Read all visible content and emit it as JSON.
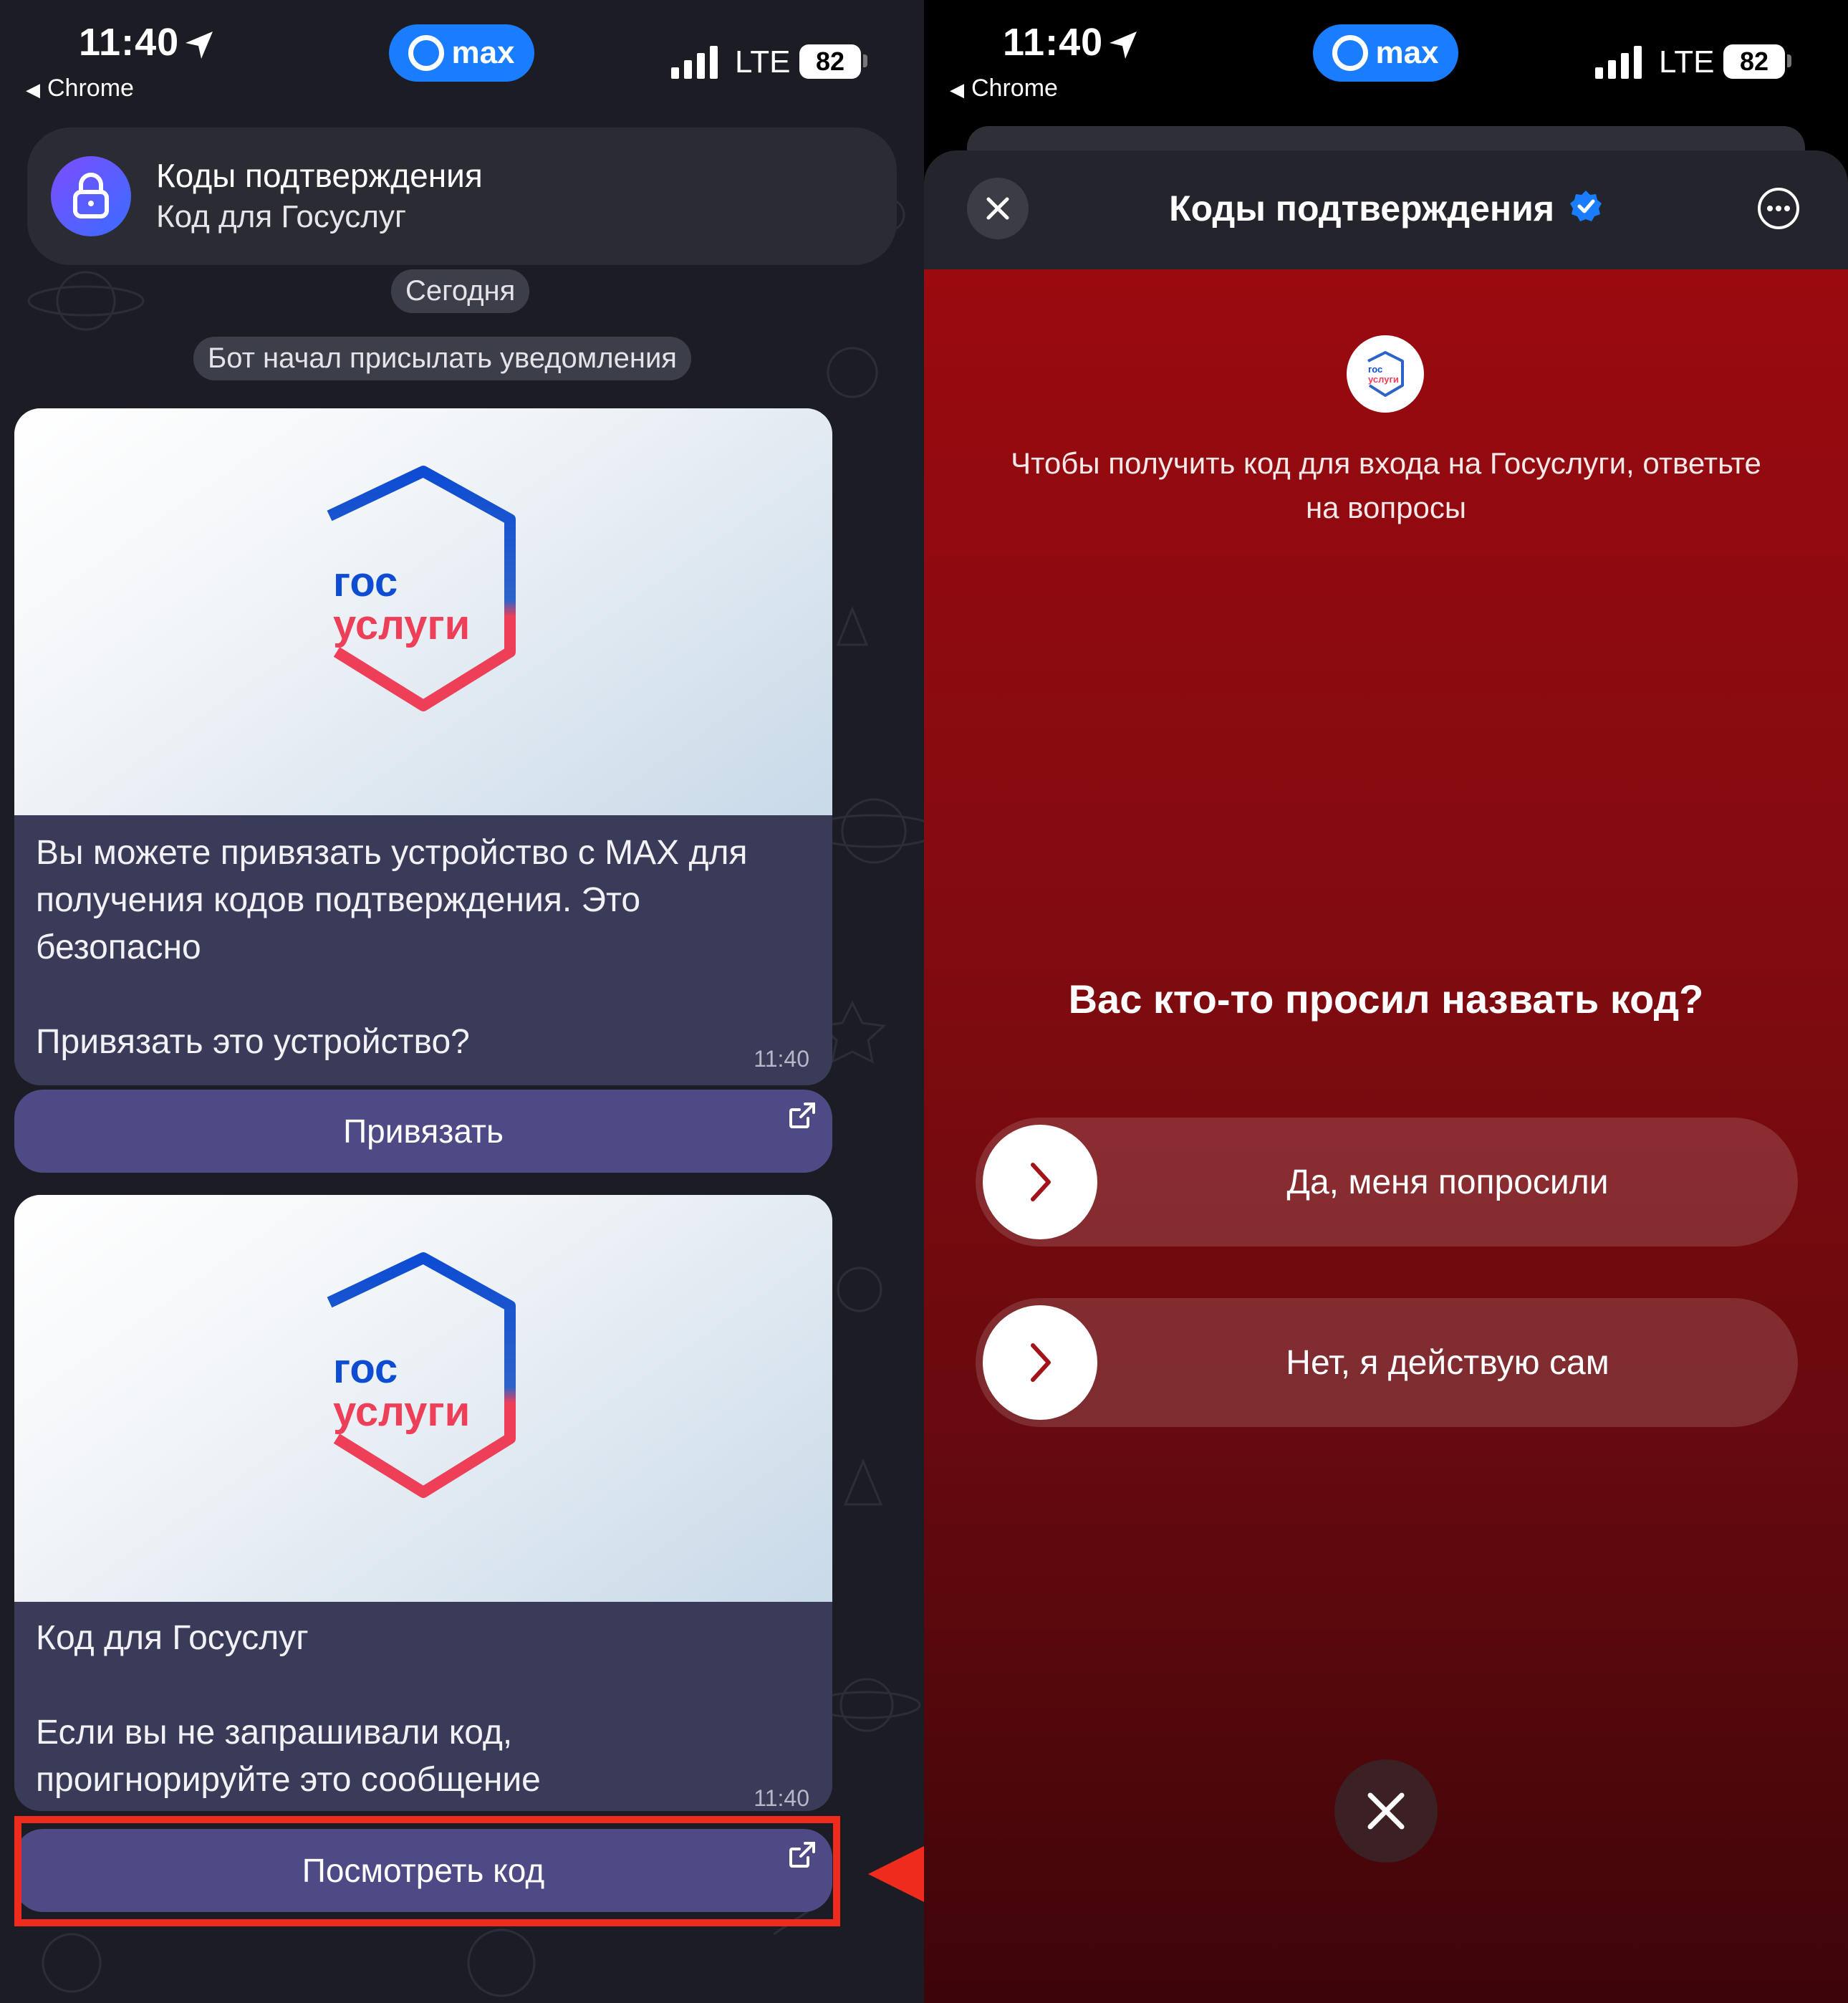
{
  "status_bar": {
    "time": "11:40",
    "back_app": "Chrome",
    "app_badge": "max",
    "network": "LTE",
    "battery": "82"
  },
  "left": {
    "header": {
      "title": "Коды подтверждения",
      "subtitle": "Код для Госуслуг"
    },
    "date_label": "Сегодня",
    "system_message": "Бот начал присылать уведомления",
    "logo_text": {
      "line1": "гос",
      "line2": "услуги"
    },
    "message1": {
      "lines": [
        "Вы можете привязать устройство с MAX для",
        "получения кодов подтверждения. Это",
        "безопасно",
        "",
        "Привязать это устройство?"
      ],
      "time": "11:40",
      "button": "Привязать"
    },
    "message2": {
      "lines": [
        "Код для Госуслуг",
        "",
        "Если вы не запрашивали код,",
        "проигнорируйте это сообщение"
      ],
      "time": "11:40",
      "button": "Посмотреть код"
    }
  },
  "right": {
    "title": "Коды подтверждения",
    "logo_text": {
      "line1": "гос",
      "line2": "услуги"
    },
    "description_lines": [
      "Чтобы получить код для входа на Госуслуги, ответьте",
      "на вопросы"
    ],
    "question": "Вас кто-то просил назвать код?",
    "options": [
      "Да, меня попросили",
      "Нет, я действую сам"
    ]
  },
  "colors": {
    "annotation": "#ef2b1e",
    "max_brand": "#1a7dff",
    "bubble_button": "#4e4a86",
    "warning_red": "#9a0a0f"
  }
}
